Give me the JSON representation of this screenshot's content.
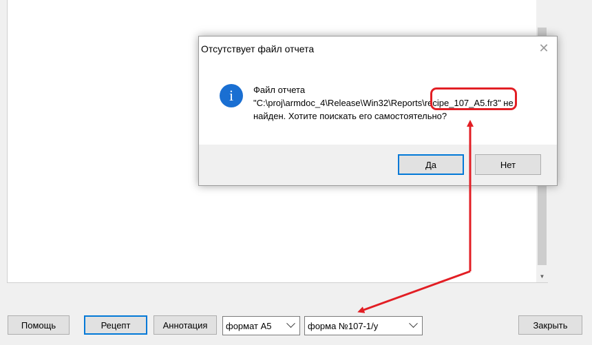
{
  "dialog": {
    "title": "Отсутствует файл отчета",
    "close_glyph": "✕",
    "icon": "info-icon",
    "icon_glyph": "i",
    "message_line1": "Файл отчета",
    "message_line2": "\"C:\\proj\\armdoc_4\\Release\\Win32\\Reports\\recipe_107_A5.fr3\" не",
    "message_line3": "найден. Хотите поискать его самостоятельно?",
    "yes_label": "Да",
    "no_label": "Нет"
  },
  "toolbar": {
    "help_label": "Помощь",
    "recipe_label": "Рецепт",
    "annotation_label": "Аннотация",
    "format_value": "формат А5",
    "form_value": "форма №107-1/у",
    "close_label": "Закрыть"
  },
  "colors": {
    "accent": "#0078d7",
    "annotation": "#e21e24",
    "info_icon": "#1a6fd2"
  }
}
